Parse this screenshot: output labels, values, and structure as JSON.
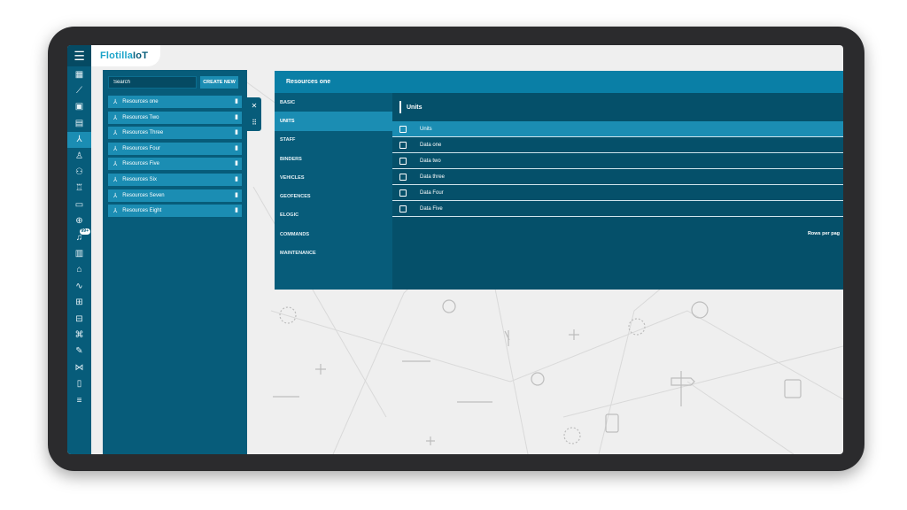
{
  "app": {
    "logo": "FlotillaIoT",
    "logo_prefix": "Flotilla",
    "logo_suffix": "IoT"
  },
  "rail": {
    "menu_icon": "hamburger-icon",
    "icons": [
      {
        "name": "dashboard-icon",
        "glyph": "▦"
      },
      {
        "name": "chart-icon",
        "glyph": "⟋"
      },
      {
        "name": "monitor-icon",
        "glyph": "▣"
      },
      {
        "name": "report-icon",
        "glyph": "▤"
      },
      {
        "name": "resources-icon",
        "glyph": "⅄",
        "active": true
      },
      {
        "name": "user-icon",
        "glyph": "♙"
      },
      {
        "name": "users-icon",
        "glyph": "⚇"
      },
      {
        "name": "driver-icon",
        "glyph": "♖"
      },
      {
        "name": "vehicle-icon",
        "glyph": "▭"
      },
      {
        "name": "geofence-icon",
        "glyph": "⊕"
      },
      {
        "name": "notification-icon",
        "glyph": "♫",
        "badge": "99+"
      },
      {
        "name": "document-icon",
        "glyph": "▥"
      },
      {
        "name": "map-user-icon",
        "glyph": "⌂"
      },
      {
        "name": "route-icon",
        "glyph": "∿"
      },
      {
        "name": "geo-report-icon",
        "glyph": "⊞"
      },
      {
        "name": "truck-icon",
        "glyph": "⊟"
      },
      {
        "name": "command-icon",
        "glyph": "⌘"
      },
      {
        "name": "wrench-icon",
        "glyph": "✎"
      },
      {
        "name": "workflow-icon",
        "glyph": "⋈"
      },
      {
        "name": "trash-icon",
        "glyph": "▯"
      },
      {
        "name": "settings-sliders-icon",
        "glyph": "≡"
      }
    ]
  },
  "resources": {
    "search_placeholder": "Search",
    "create_label": "CREATE NEW",
    "items": [
      "Resources one",
      "Resources Two",
      "Resources Three",
      "Resources Four",
      "Resources Five",
      "Resources Six",
      "Resources Seven",
      "Resources Eight"
    ],
    "close_glyph": "✕",
    "drag_glyph": "⠿"
  },
  "detail": {
    "title": "Resources one",
    "nav": [
      "BASIC",
      "UNITS",
      "STAFF",
      "BINDERS",
      "VEHICLES",
      "GEOFENCES",
      "ELOGIC",
      "COMMANDS",
      "MAINTENANCE"
    ],
    "active_nav": 1,
    "units": {
      "title": "Units",
      "header": "Units",
      "rows": [
        "Data one",
        "Data two",
        "Data three",
        "Data Four",
        "Data Five"
      ],
      "rows_per_page": "Rows per pag"
    }
  },
  "colors": {
    "primary": "#075c7a",
    "accent": "#1b8db3",
    "header": "#0a7fa6"
  }
}
